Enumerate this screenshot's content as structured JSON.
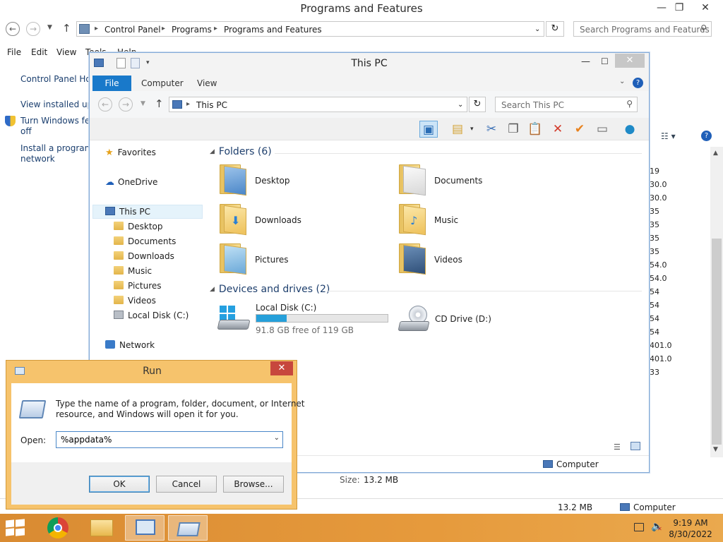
{
  "background_window": {
    "title": "Programs and Features",
    "breadcrumbs": [
      "Control Panel",
      "Programs",
      "Programs and Features"
    ],
    "search_placeholder": "Search Programs and Features",
    "menu": [
      "File",
      "Edit",
      "View",
      "Tools",
      "Help"
    ],
    "sidebar_links": [
      "Control Panel Hom",
      "View installed upd",
      "Turn Windows fea",
      "off",
      "Install a program",
      "network"
    ],
    "version_column": [
      "19",
      "30.0",
      "30.0",
      "35",
      "35",
      "35",
      "35",
      "54.0",
      "54.0",
      "54",
      "54",
      "54",
      "54",
      "401.0",
      "401.0",
      "33"
    ],
    "size_label": "Size:",
    "size_value": "13.2 MB",
    "status_size": "13.2 MB",
    "status_location": "Computer"
  },
  "explorer": {
    "title": "This PC",
    "ribbon_tabs": [
      "File",
      "Computer",
      "View"
    ],
    "address": "This PC",
    "search_placeholder": "Search This PC",
    "nav": {
      "favorites": "Favorites",
      "onedrive": "OneDrive",
      "thispc": "This PC",
      "children": [
        "Desktop",
        "Documents",
        "Downloads",
        "Music",
        "Pictures",
        "Videos",
        "Local Disk (C:)"
      ],
      "network": "Network"
    },
    "folders_header": "Folders (6)",
    "folders": [
      "Desktop",
      "Documents",
      "Downloads",
      "Music",
      "Pictures",
      "Videos"
    ],
    "devices_header": "Devices and drives (2)",
    "local_disk": {
      "name": "Local Disk (C:)",
      "free_text": "91.8 GB free of 119 GB",
      "used_fraction": 0.23
    },
    "cd_drive": "CD Drive (D:)",
    "status_location": "Computer"
  },
  "run_dialog": {
    "title": "Run",
    "description_line1": "Type the name of a program, folder, document, or Internet",
    "description_line2": "resource, and Windows will open it for you.",
    "open_label": "Open:",
    "open_value": "%appdata%",
    "ok": "OK",
    "cancel": "Cancel",
    "browse": "Browse..."
  },
  "taskbar": {
    "time": "9:19 AM",
    "date": "8/30/2022"
  },
  "colors": {
    "accent_blue": "#1979ca",
    "taskbar_orange": "#e69a3c",
    "run_frame": "#f6c36c",
    "close_red": "#c7473d",
    "drive_fill": "#26a0da"
  }
}
